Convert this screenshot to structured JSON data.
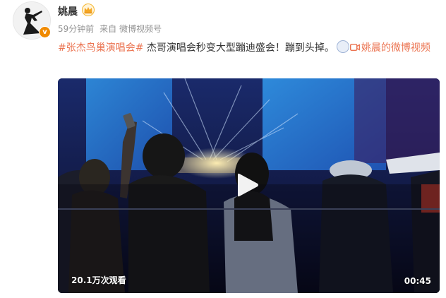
{
  "post": {
    "username": "姚晨",
    "time": "59分钟前",
    "source_prefix": "来自",
    "source": "微博视频号",
    "topic": "#张杰鸟巢演唱会#",
    "text": " 杰哥演唱会秒变大型蹦迪盛会！蹦到头掉。",
    "video_link": "姚晨的微博视频",
    "video": {
      "views": "20.1万次观看",
      "duration": "00:45"
    }
  },
  "colors": {
    "link": "#eb7350",
    "meta": "#939393",
    "verify": "#f08a00"
  },
  "icons": {
    "avatar": "avatar-image",
    "verify": "verified-badge-icon",
    "crown": "crown-icon",
    "emoji": "emoji-icon",
    "video": "video-camera-icon",
    "play": "play-icon"
  }
}
